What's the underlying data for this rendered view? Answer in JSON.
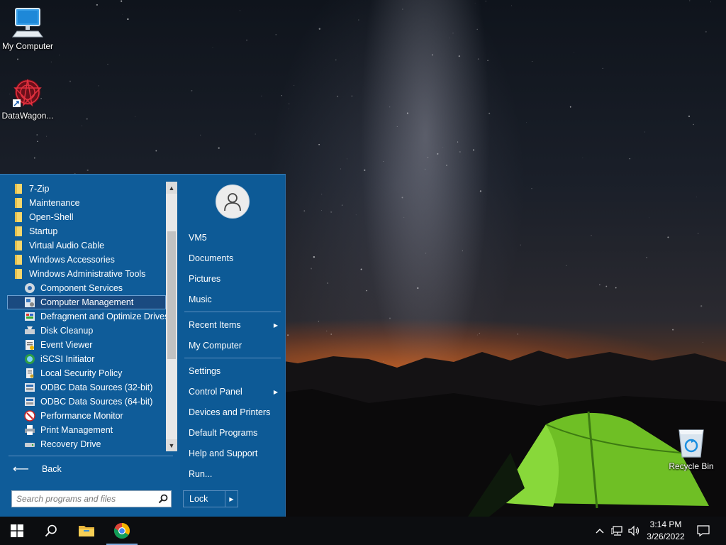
{
  "desktop": {
    "icons": [
      {
        "label": "My Computer",
        "icon": "computer-icon"
      },
      {
        "label": "DataWagon...",
        "icon": "datawagon-icon"
      },
      {
        "label": "Recycle Bin",
        "icon": "recycle-bin-icon"
      }
    ]
  },
  "start_menu": {
    "programs": [
      {
        "label": "7-Zip",
        "icon": "folder-icon",
        "kind": "folder"
      },
      {
        "label": "Maintenance",
        "icon": "folder-icon",
        "kind": "folder"
      },
      {
        "label": "Open-Shell",
        "icon": "folder-icon",
        "kind": "folder"
      },
      {
        "label": "Startup",
        "icon": "folder-icon",
        "kind": "folder"
      },
      {
        "label": "Virtual Audio Cable",
        "icon": "folder-icon",
        "kind": "folder"
      },
      {
        "label": "Windows Accessories",
        "icon": "folder-icon",
        "kind": "folder"
      },
      {
        "label": "Windows Administrative Tools",
        "icon": "folder-icon",
        "kind": "folder"
      },
      {
        "label": "Component Services",
        "icon": "component-services-icon",
        "kind": "tool"
      },
      {
        "label": "Computer Management",
        "icon": "computer-management-icon",
        "kind": "tool",
        "selected": true
      },
      {
        "label": "Defragment and Optimize Drives",
        "icon": "defragment-icon",
        "kind": "tool"
      },
      {
        "label": "Disk Cleanup",
        "icon": "disk-cleanup-icon",
        "kind": "tool"
      },
      {
        "label": "Event Viewer",
        "icon": "event-viewer-icon",
        "kind": "tool"
      },
      {
        "label": "iSCSI Initiator",
        "icon": "iscsi-icon",
        "kind": "tool"
      },
      {
        "label": "Local Security Policy",
        "icon": "security-policy-icon",
        "kind": "tool"
      },
      {
        "label": "ODBC Data Sources (32-bit)",
        "icon": "odbc-icon",
        "kind": "tool"
      },
      {
        "label": "ODBC Data Sources (64-bit)",
        "icon": "odbc-icon",
        "kind": "tool"
      },
      {
        "label": "Performance Monitor",
        "icon": "performance-monitor-icon",
        "kind": "tool"
      },
      {
        "label": "Print Management",
        "icon": "print-management-icon",
        "kind": "tool"
      },
      {
        "label": "Recovery Drive",
        "icon": "recovery-drive-icon",
        "kind": "tool"
      }
    ],
    "back_label": "Back",
    "search_placeholder": "Search programs and files",
    "right_items": [
      {
        "label": "VM5",
        "submenu": false
      },
      {
        "label": "Documents",
        "submenu": false
      },
      {
        "label": "Pictures",
        "submenu": false
      },
      {
        "label": "Music",
        "submenu": false
      },
      {
        "label": "Recent Items",
        "submenu": true
      },
      {
        "label": "My Computer",
        "submenu": false
      },
      {
        "label": "Settings",
        "submenu": false
      },
      {
        "label": "Control Panel",
        "submenu": true
      },
      {
        "label": "Devices and Printers",
        "submenu": false
      },
      {
        "label": "Default Programs",
        "submenu": false
      },
      {
        "label": "Help and Support",
        "submenu": false
      },
      {
        "label": "Run...",
        "submenu": false
      }
    ],
    "lock_label": "Lock"
  },
  "taskbar": {
    "buttons": [
      {
        "icon": "windows-start-icon"
      },
      {
        "icon": "search-icon"
      },
      {
        "icon": "file-explorer-icon"
      },
      {
        "icon": "chrome-icon",
        "active": true
      }
    ],
    "tray": {
      "icons": [
        "chevron-up-icon",
        "network-icon",
        "volume-icon",
        "notification-icon"
      ],
      "time": "3:14 PM",
      "date": "3/26/2022"
    }
  },
  "colors": {
    "start_menu_bg": "#0d5a96",
    "taskbar_bg": "#0c0d10",
    "folder": "#f5d66b"
  }
}
